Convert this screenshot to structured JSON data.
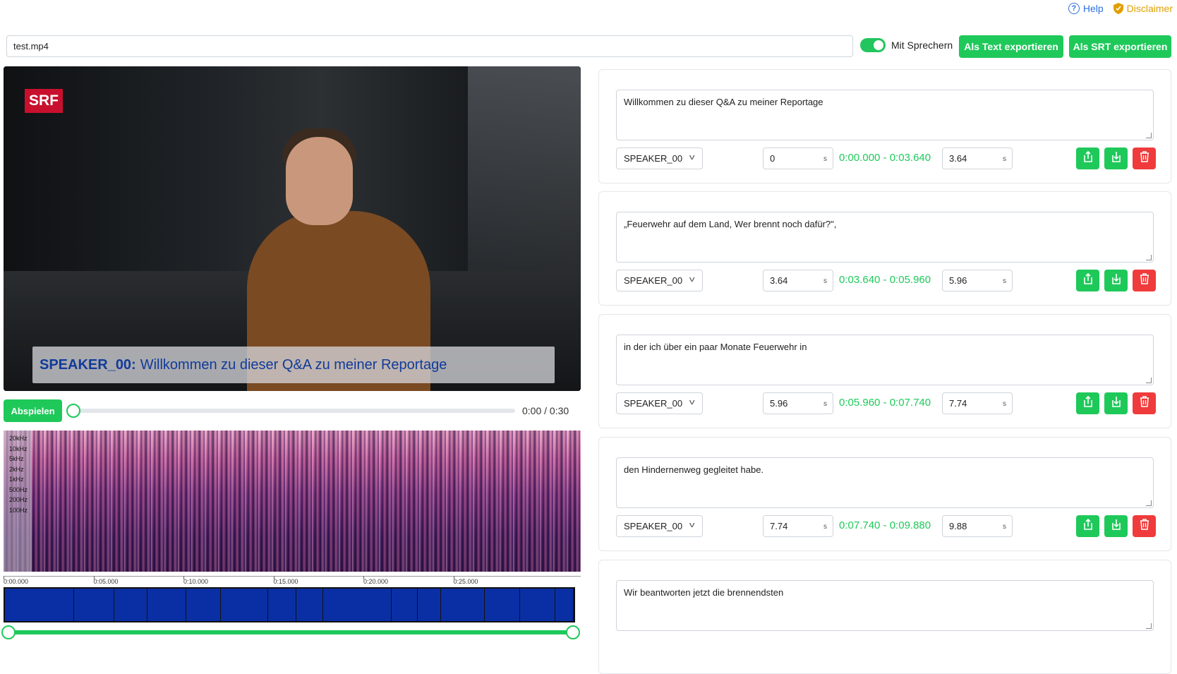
{
  "header": {
    "help_label": "Help",
    "disclaimer_label": "Disclaimer"
  },
  "file": {
    "name": "test.mp4"
  },
  "controls": {
    "speakers_toggle_label": "Mit Sprechern",
    "speakers_toggle_on": true,
    "export_text_label": "Als Text exportieren",
    "export_srt_label": "Als SRT exportieren"
  },
  "video": {
    "logo": "SRF",
    "caption_speaker": "SPEAKER_00:",
    "caption_text": "Willkommen zu dieser Q&A zu meiner Reportage"
  },
  "player": {
    "play_label": "Abspielen",
    "time_display": "0:00 / 0:30",
    "progress": 0
  },
  "spectrogram": {
    "freq_labels": [
      "20kHz",
      "10kHz",
      "5kHz",
      "2kHz",
      "1kHz",
      "500Hz",
      "200Hz",
      "100Hz"
    ],
    "time_ticks": [
      "0:00.000",
      "0:05.000",
      "0:10.000",
      "0:15.000",
      "0:20.000",
      "0:25.000"
    ]
  },
  "segments": [
    {
      "text": "Willkommen zu dieser Q&A zu meiner Reportage",
      "speaker": "SPEAKER_00",
      "start": "0",
      "end": "3.64",
      "range": "0:00.000  -  0:03.640"
    },
    {
      "text": "„Feuerwehr auf dem Land, Wer brennt noch dafür?\",",
      "speaker": "SPEAKER_00",
      "start": "3.64",
      "end": "5.96",
      "range": "0:03.640  -  0:05.960"
    },
    {
      "text": "in der ich über ein paar Monate Feuerwehr in",
      "speaker": "SPEAKER_00",
      "start": "5.96",
      "end": "7.74",
      "range": "0:05.960  -  0:07.740"
    },
    {
      "text": "den Hindernenweg gegleitet habe.",
      "speaker": "SPEAKER_00",
      "start": "7.74",
      "end": "9.88",
      "range": "0:07.740  -  0:09.880"
    },
    {
      "text": "Wir beantworten jetzt die brennendsten"
    }
  ],
  "unit": "s",
  "colors": {
    "accent": "#1ec95a",
    "danger": "#ef3b3b",
    "segment_bar": "#0a2fa4",
    "link": "#2f6fe0",
    "warning": "#e0a000"
  }
}
